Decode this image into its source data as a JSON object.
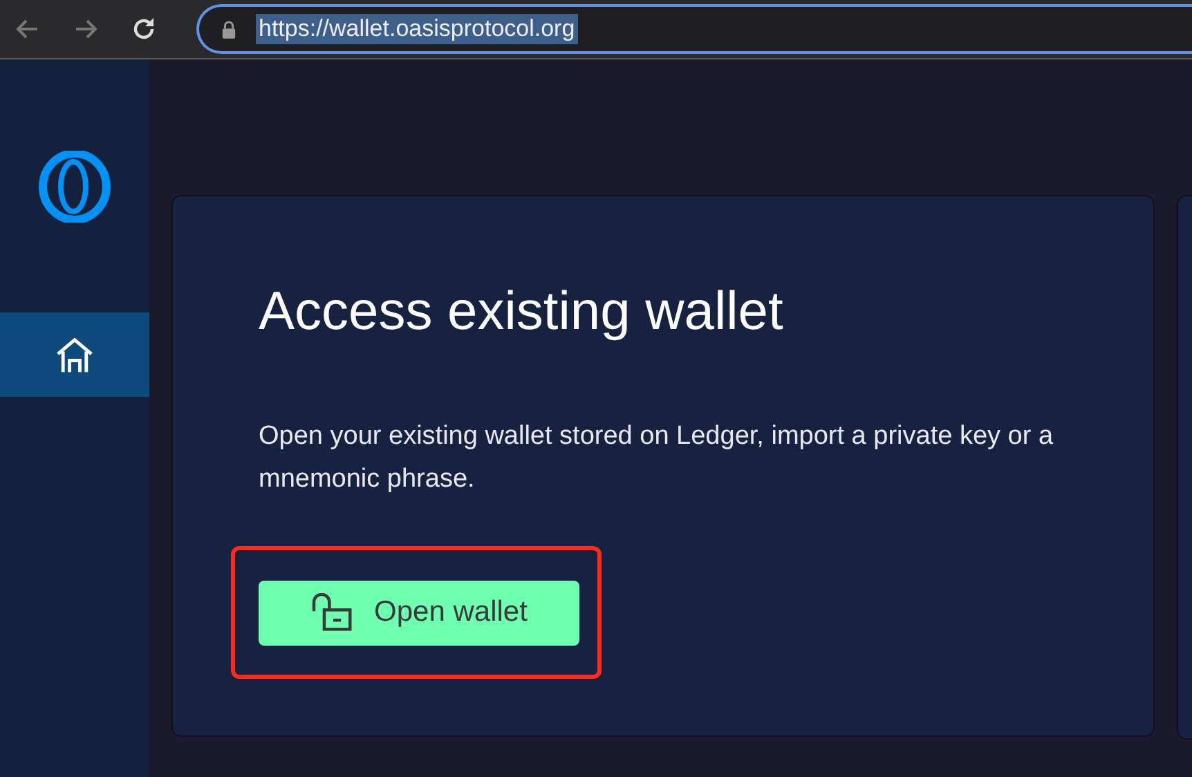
{
  "browser": {
    "url": "https://wallet.oasisprotocol.org"
  },
  "sidebar": {
    "items": [
      {
        "kind": "home",
        "selected": true
      }
    ]
  },
  "card": {
    "title": "Access existing wallet",
    "description": "Open your existing wallet stored on Ledger, import a private key or a mnemonic phrase.",
    "button": "Open wallet",
    "highlighted": true
  }
}
